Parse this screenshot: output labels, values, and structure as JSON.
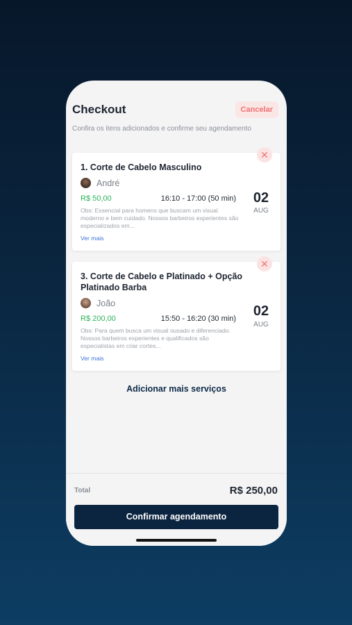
{
  "header": {
    "title": "Checkout",
    "cancel_label": "Cancelar"
  },
  "subtitle": "Confira os itens adicionados e confirme seu agendamento",
  "items": [
    {
      "name": "1. Corte de Cabelo Masculino",
      "barber": "André",
      "price": "R$ 50,00",
      "time": "16:10 - 17:00 (50 min)",
      "day": "02",
      "month": "AUG",
      "obs": "Obs: Essencial para homens que buscam um visual moderno e bem cuidado. Nossos barbeiros experientes são especializados em...",
      "more_label": "Ver mais",
      "remove_icon": "close-icon"
    },
    {
      "name": "3. Corte de Cabelo e Platinado + Opção Platinado Barba",
      "barber": "João",
      "price": "R$ 200,00",
      "time": "15:50 - 16:20 (30 min)",
      "day": "02",
      "month": "AUG",
      "obs": "Obs: Para quem busca um visual ousado e diferenciado. Nossos barbeiros experientes e qualificados são especialistas em criar cortes...",
      "more_label": "Ver mais",
      "remove_icon": "close-icon"
    }
  ],
  "add_more_label": "Adicionar mais serviços",
  "footer": {
    "total_label": "Total",
    "total_value": "R$ 250,00",
    "confirm_label": "Confirmar agendamento"
  },
  "colors": {
    "primary": "#0b2440",
    "price_green": "#2bb357",
    "cancel_red": "#f07171",
    "link_blue": "#3a72d6"
  }
}
